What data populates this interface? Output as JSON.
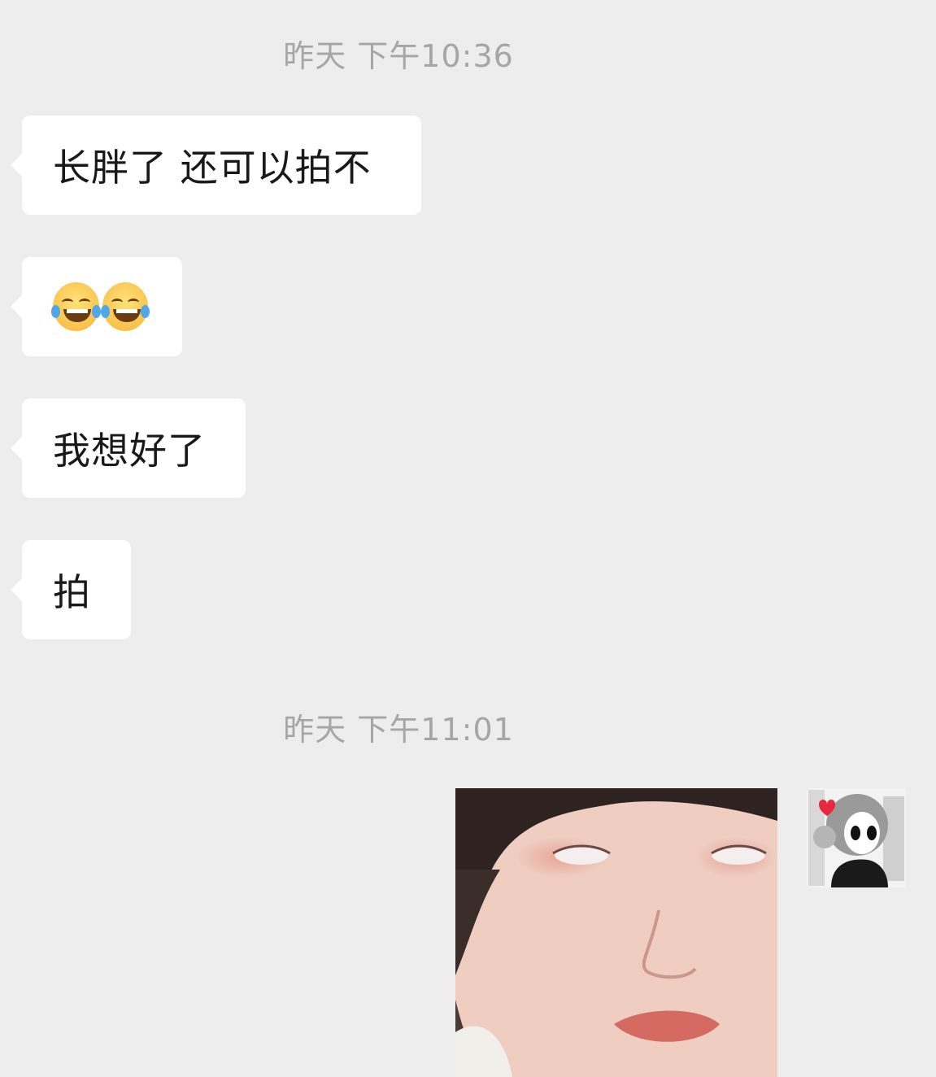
{
  "chat": {
    "timestamp1": "昨天 下午10:36",
    "msg1": "长胖了 还可以拍不",
    "msg2_icon": "face-with-tears-of-joy-icon",
    "msg3": "我想好了",
    "msg4": "拍",
    "timestamp2": "昨天 下午11:01",
    "sent_image": "selfie-eye-roll-image",
    "avatar": "cartoon-avatar-image"
  },
  "colors": {
    "background": "#ededed",
    "bubble": "#ffffff",
    "timestamp_text": "#a6a6a6",
    "message_text": "#191919"
  }
}
